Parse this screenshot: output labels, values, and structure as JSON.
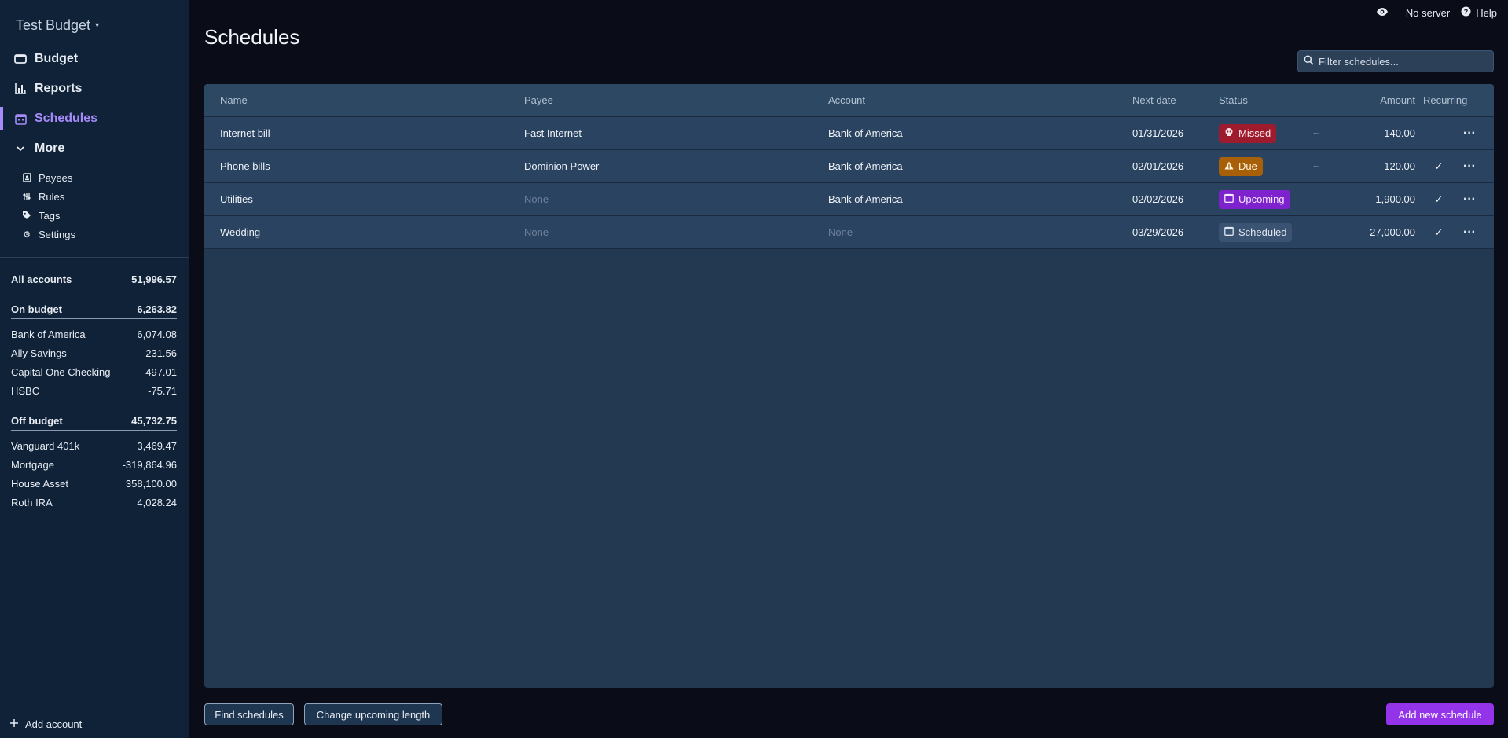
{
  "app": {
    "budget_name": "Test Budget",
    "caret": "▾"
  },
  "sidebar": {
    "nav": [
      {
        "label": "Budget",
        "icon": "wallet-icon"
      },
      {
        "label": "Reports",
        "icon": "bar-chart-icon"
      },
      {
        "label": "Schedules",
        "icon": "calendar-icon",
        "active": true
      },
      {
        "label": "More",
        "icon": "chevron-down-icon"
      }
    ],
    "more_items": [
      {
        "label": "Payees",
        "icon": "payees-icon"
      },
      {
        "label": "Rules",
        "icon": "rules-icon"
      },
      {
        "label": "Tags",
        "icon": "tag-icon"
      },
      {
        "label": "Settings",
        "icon": "gear-icon"
      }
    ],
    "all_accounts": {
      "label": "All accounts",
      "value": "51,996.57"
    },
    "on_budget": {
      "label": "On budget",
      "value": "6,263.82"
    },
    "on_budget_accounts": [
      {
        "name": "Bank of America",
        "value": "6,074.08"
      },
      {
        "name": "Ally Savings",
        "value": "-231.56"
      },
      {
        "name": "Capital One Checking",
        "value": "497.01"
      },
      {
        "name": "HSBC",
        "value": "-75.71"
      }
    ],
    "off_budget": {
      "label": "Off budget",
      "value": "45,732.75"
    },
    "off_budget_accounts": [
      {
        "name": "Vanguard 401k",
        "value": "3,469.47"
      },
      {
        "name": "Mortgage",
        "value": "-319,864.96"
      },
      {
        "name": "House Asset",
        "value": "358,100.00"
      },
      {
        "name": "Roth IRA",
        "value": "4,028.24"
      }
    ],
    "add_account": "Add account"
  },
  "topbar": {
    "server": "No server",
    "help": "Help"
  },
  "page": {
    "title": "Schedules",
    "filter_placeholder": "Filter schedules..."
  },
  "table": {
    "headers": {
      "name": "Name",
      "payee": "Payee",
      "account": "Account",
      "next_date": "Next date",
      "status": "Status",
      "amount": "Amount",
      "recurring": "Recurring"
    },
    "rows": [
      {
        "name": "Internet bill",
        "payee": "Fast Internet",
        "payee_muted": false,
        "account": "Bank of America",
        "account_muted": false,
        "next_date": "01/31/2026",
        "status": "Missed",
        "status_kind": "missed",
        "approx": "~",
        "amount": "140.00",
        "recurring": "",
        "menu": "···"
      },
      {
        "name": "Phone bills",
        "payee": "Dominion Power",
        "payee_muted": false,
        "account": "Bank of America",
        "account_muted": false,
        "next_date": "02/01/2026",
        "status": "Due",
        "status_kind": "due",
        "approx": "~",
        "amount": "120.00",
        "recurring": "✓",
        "menu": "···"
      },
      {
        "name": "Utilities",
        "payee": "None",
        "payee_muted": true,
        "account": "Bank of America",
        "account_muted": false,
        "next_date": "02/02/2026",
        "status": "Upcoming",
        "status_kind": "upcoming",
        "approx": "",
        "amount": "1,900.00",
        "recurring": "✓",
        "menu": "···"
      },
      {
        "name": "Wedding",
        "payee": "None",
        "payee_muted": true,
        "account": "None",
        "account_muted": true,
        "next_date": "03/29/2026",
        "status": "Scheduled",
        "status_kind": "scheduled",
        "approx": "",
        "amount": "27,000.00",
        "recurring": "✓",
        "menu": "···"
      }
    ]
  },
  "footer": {
    "find": "Find schedules",
    "change_length": "Change upcoming length",
    "add_new": "Add new schedule"
  }
}
